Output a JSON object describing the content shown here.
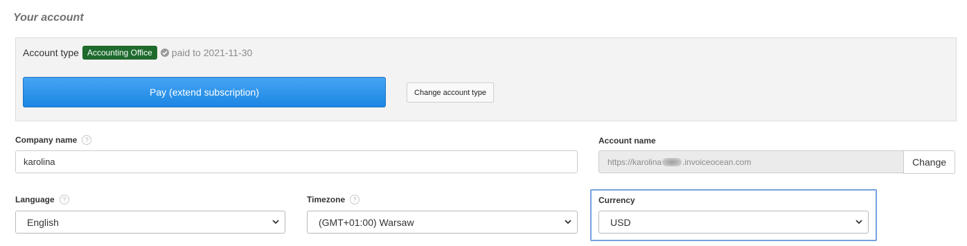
{
  "section": {
    "title": "Your account"
  },
  "account_box": {
    "type_label": "Account type",
    "type_badge": "Accounting Office",
    "paid_text": "paid to 2021-11-30",
    "pay_button": "Pay (extend subscription)",
    "change_type_button": "Change account type"
  },
  "company": {
    "label": "Company name",
    "value": "karolina"
  },
  "account_name": {
    "label": "Account name",
    "url_prefix": "https://karolina",
    "url_suffix": ".invoiceocean.com",
    "change_button": "Change"
  },
  "language": {
    "label": "Language",
    "selected": "English"
  },
  "timezone": {
    "label": "Timezone",
    "selected": "(GMT+01:00) Warsaw"
  },
  "currency": {
    "label": "Currency",
    "selected": "USD"
  },
  "help_glyph": "?",
  "colors": {
    "badge": "#1e6b2d",
    "pay_button": "#2b8fe8",
    "highlight": "#75a2e0"
  }
}
